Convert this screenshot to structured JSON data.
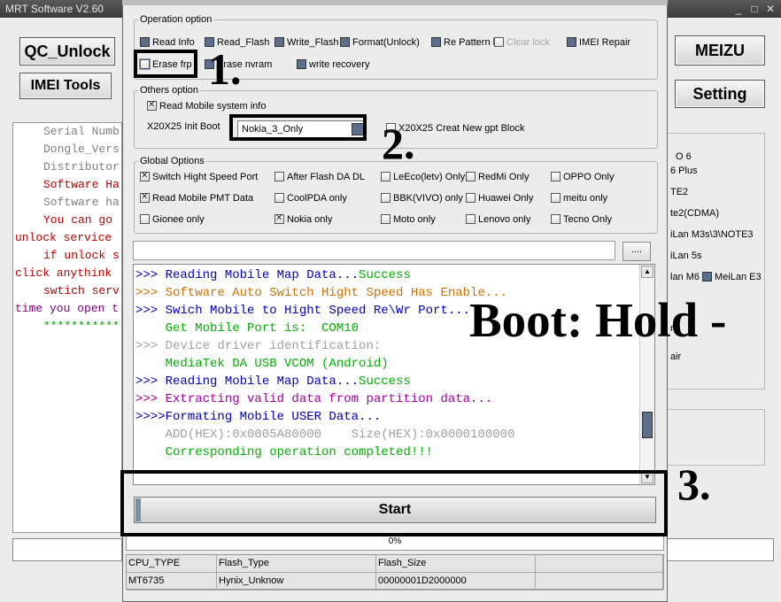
{
  "background_window": {
    "title": "MRT Software V2.60",
    "window_controls": [
      "_",
      "□",
      "✕"
    ],
    "buttons": {
      "qc_unlock": "QC_Unlock",
      "imei_tools": "IMEI Tools",
      "meizu": "MEIZU",
      "setting": "Setting"
    },
    "info_lines": [
      {
        "text": "Serial Numb",
        "color": "#808080",
        "indent": true
      },
      {
        "text": "Dongle_Vers",
        "color": "#808080",
        "indent": true
      },
      {
        "text": "Distributor",
        "color": "#808080",
        "indent": true
      },
      {
        "text": "Software Ha",
        "color": "#c00000",
        "indent": true
      },
      {
        "text": "Software ha",
        "color": "#808080",
        "indent": true
      },
      {
        "text": "You can go ",
        "color": "#c00000",
        "indent": true
      },
      {
        "text": "unlock service",
        "color": "#c00000",
        "indent": false
      },
      {
        "text": "if unlock s",
        "color": "#c00000",
        "indent": true
      },
      {
        "text": "click anythink",
        "color": "#c00000",
        "indent": false
      },
      {
        "text": "swtich serv",
        "color": "#c00000",
        "indent": true
      },
      {
        "text": "time you open t",
        "color": "#800080",
        "indent": false
      },
      {
        "text": "***********",
        "color": "#00a000",
        "indent": true
      }
    ],
    "right_panel_items": [
      "O 6",
      "6 Plus",
      "TE2",
      "te2(CDMA)",
      "iLan M3s\\3\\NOTE3",
      "iLan 5s",
      "lan M6",
      "MeiLan E3",
      "n",
      "air"
    ]
  },
  "dialog": {
    "operation_option": {
      "title": "Operation option",
      "items": [
        {
          "label": "Read  Info",
          "checked": false,
          "dark": true,
          "disabled": false
        },
        {
          "label": "Read_Flash",
          "checked": false,
          "dark": true,
          "disabled": false
        },
        {
          "label": "Write_Flash",
          "checked": false,
          "dark": true,
          "disabled": false
        },
        {
          "label": "Format(Unlock)",
          "checked": false,
          "dark": true,
          "disabled": false
        },
        {
          "label": "Re Pattern lo",
          "checked": false,
          "dark": true,
          "disabled": false
        },
        {
          "label": "Clear lock",
          "checked": false,
          "dark": false,
          "disabled": true
        },
        {
          "label": "IMEI Repair",
          "checked": false,
          "dark": true,
          "disabled": false
        },
        {
          "label": "Erase frp",
          "checked": false,
          "dark": false,
          "disabled": false,
          "focused": true
        },
        {
          "label": "Erase nvram",
          "checked": false,
          "dark": true,
          "disabled": false
        },
        {
          "label": "write recovery",
          "checked": false,
          "dark": true,
          "disabled": false
        }
      ]
    },
    "others_option": {
      "title": "Others option",
      "read_mobile_system_info": {
        "label": "Read Mobile system info",
        "checked": true
      },
      "init_boot_label": "X20X25 Init Boot",
      "init_boot_value": "Nokia_3_Only",
      "new_gpt": {
        "label": "X20X25 Creat New gpt Block",
        "checked": false
      }
    },
    "global_options": {
      "title": "Global Options",
      "items": [
        {
          "label": "Switch Hight Speed Port",
          "checked": true
        },
        {
          "label": "After Flash DA DL",
          "checked": false
        },
        {
          "label": "LeEco(letv) Only",
          "checked": false
        },
        {
          "label": "RedMi Only",
          "checked": false
        },
        {
          "label": "OPPO Only",
          "checked": false
        },
        {
          "label": "Read Mobile PMT Data",
          "checked": true
        },
        {
          "label": "CoolPDA only",
          "checked": false
        },
        {
          "label": "BBK(VIVO) only",
          "checked": false
        },
        {
          "label": "Huawei Only",
          "checked": false
        },
        {
          "label": "meitu only",
          "checked": false
        },
        {
          "label": "Gionee only",
          "checked": false
        },
        {
          "label": "Nokia only",
          "checked": true
        },
        {
          "label": "Moto only",
          "checked": false
        },
        {
          "label": "Lenovo only",
          "checked": false
        },
        {
          "label": "Tecno Only",
          "checked": false
        }
      ]
    },
    "path_value": "",
    "browse_label": "....",
    "log": [
      {
        "parts": [
          {
            "text": ">>> Reading Mobile Map Data...",
            "color": "#0000c0"
          },
          {
            "text": "Success",
            "color": "#00b000"
          }
        ]
      },
      {
        "parts": [
          {
            "text": ">>> Software Auto Switch Hight Speed Has Enable...",
            "color": "#d07000"
          }
        ]
      },
      {
        "parts": [
          {
            "text": ">>> Swich Mobile to Hight Speed Re\\Wr Port...",
            "color": "#0000c0"
          }
        ]
      },
      {
        "parts": [
          {
            "text": "    Get Mobile Port is:  COM10",
            "color": "#00b000"
          }
        ]
      },
      {
        "parts": [
          {
            "text": ">>> Device driver identification:",
            "color": "#a0a0a0"
          }
        ]
      },
      {
        "parts": [
          {
            "text": "    MediaTek DA USB VCOM (Android)",
            "color": "#00b000"
          }
        ]
      },
      {
        "parts": [
          {
            "text": ">>> Reading Mobile Map Data...",
            "color": "#0000c0"
          },
          {
            "text": "Success",
            "color": "#00b000"
          }
        ]
      },
      {
        "parts": [
          {
            "text": ">>> Extracting valid data from partition data...",
            "color": "#a000a0"
          }
        ]
      },
      {
        "parts": [
          {
            "text": ">>>>Formating Mobile USER Data...",
            "color": "#0000c0"
          }
        ]
      },
      {
        "parts": [
          {
            "text": "    ADD(HEX):0x0005A80000    Size(HEX):0x0000100000",
            "color": "#a0a0a0"
          }
        ]
      },
      {
        "parts": [
          {
            "text": "    Corresponding operation completed!!!",
            "color": "#00b000"
          }
        ]
      }
    ],
    "start_label": "Start",
    "progress": {
      "value": 0,
      "text": "0%"
    },
    "info_table": {
      "headers": [
        "CPU_TYPE",
        "Flash_Type",
        "Flash_Size",
        ""
      ],
      "values": [
        "MT6735",
        "Hynix_Unknow",
        "00000001D2000000",
        ""
      ]
    }
  },
  "annotations": {
    "step1": "1.",
    "step2": "2.",
    "step3": "3.",
    "boot_text": "Boot: Hold -"
  },
  "colors": {
    "checkbox_dark": "#5b6f8a",
    "progress_green": "#6a9a4a"
  }
}
